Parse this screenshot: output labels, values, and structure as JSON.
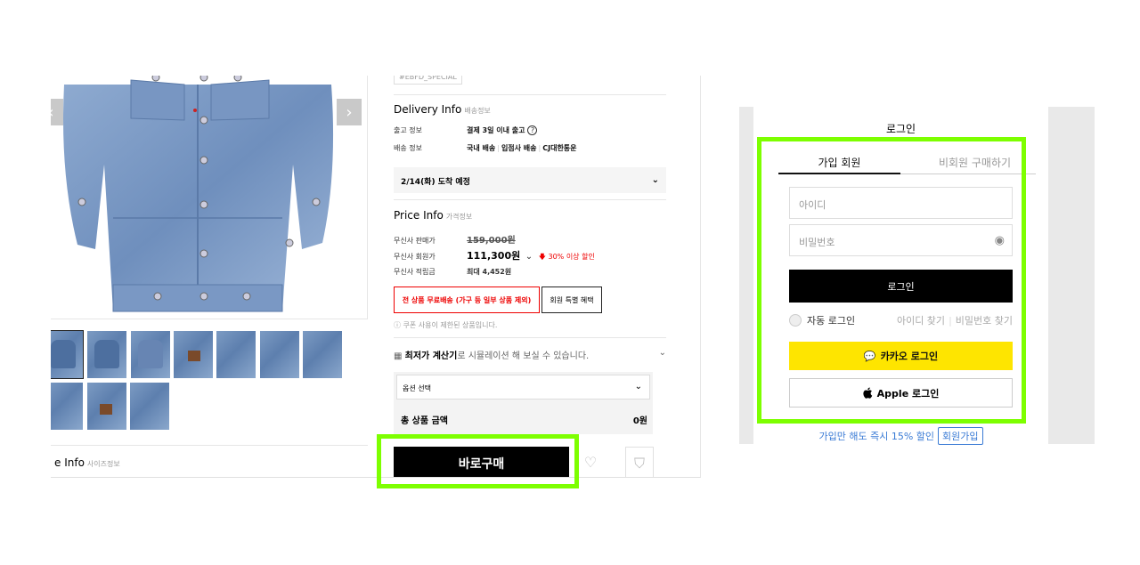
{
  "product": {
    "tag": "#EBFD_SPECIAL",
    "size_info_title": "e Info",
    "size_info_sub": "사이즈정보",
    "delivery": {
      "title": "Delivery Info",
      "subtitle": "배송정보",
      "ship_label": "출고 정보",
      "ship_value": "결제 3일 이내 출고",
      "method_label": "배송 정보",
      "methods": [
        "국내 배송",
        "입점사 배송",
        "CJ대한통운"
      ],
      "arrival": "2/14(화) 도착 예정"
    },
    "price": {
      "title": "Price Info",
      "subtitle": "가격정보",
      "sale_label": "무신사 판매가",
      "sale_value": "159,000원",
      "member_label": "무신사 회원가",
      "member_value": "111,300원",
      "discount": "30% 이상 할인",
      "points_label": "무신사 적립금",
      "points_value": "최대 4,452원"
    },
    "free_shipping_button": "전 상품 무료배송 (가구 등 일부 상품 제외)",
    "member_benefit_button": "회원 특별 혜택",
    "coupon_notice": "쿠폰 사용이 제한된 상품입니다.",
    "calc_bold": "최저가 계산기",
    "calc_text": "로 시뮬레이션 해 보실 수 있습니다.",
    "option_placeholder": "옵션 선택",
    "total_label": "총 상품 금액",
    "total_value": "0원",
    "buy_button": "바로구매"
  },
  "login": {
    "title": "로그인",
    "tab_member": "가입 회원",
    "tab_guest": "비회원 구매하기",
    "id_placeholder": "아이디",
    "password_placeholder": "비밀번호",
    "login_button": "로그인",
    "auto_login": "자동 로그인",
    "find_id": "아이디 찾기",
    "find_password": "비밀번호 찾기",
    "kakao_button": "카카오 로그인",
    "apple_button": "Apple 로그인",
    "promo_text": "가입만 해도 즉시 15% 할인",
    "join_button": "회원가입"
  },
  "colors": {
    "highlight": "#7dff00",
    "kakao": "#fee500",
    "discount_red": "#ee0000",
    "link_blue": "#3a7bd5"
  },
  "icons": [
    "chevron-left-icon",
    "chevron-right-icon",
    "help-icon",
    "chevron-down-icon",
    "arrow-down-icon",
    "info-icon",
    "calculator-icon",
    "heart-icon",
    "shopping-bag-icon",
    "eye-icon",
    "chat-bubble-icon",
    "apple-icon"
  ]
}
